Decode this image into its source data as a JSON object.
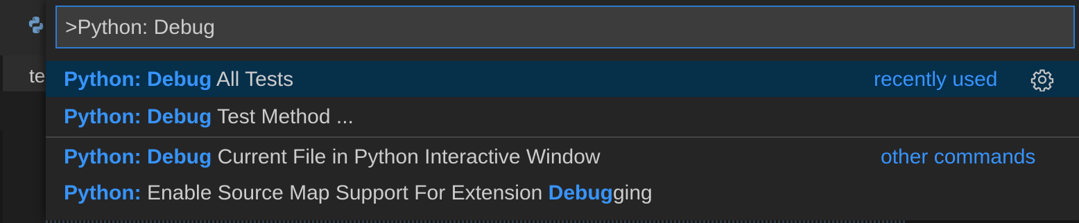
{
  "window": {
    "icon": "python-icon",
    "tab_label": "te"
  },
  "palette": {
    "input_value": ">Python: Debug",
    "items": [
      {
        "highlight": "Python: Debug",
        "rest_before": "",
        "rest": " All Tests",
        "tag": "recently used",
        "has_gear": true,
        "active": true
      },
      {
        "highlight": "Python: Debug",
        "rest": " Test Method ...",
        "tag": "",
        "active": false
      },
      {
        "highlight": "Python: Debug",
        "rest": " Current File in Python Interactive Window",
        "tag": "other commands",
        "active": false
      },
      {
        "prefix_highlight": "Python:",
        "middle": " Enable Source Map Support For Extension ",
        "suffix_highlight": "Debug",
        "suffix": "ging",
        "tag": "",
        "active": false
      }
    ],
    "gear_icon": "gear-icon"
  },
  "colors": {
    "accent": "#3794ff",
    "active_row": "#062f4a",
    "input_border": "#2e7bd1",
    "background": "#252526"
  }
}
